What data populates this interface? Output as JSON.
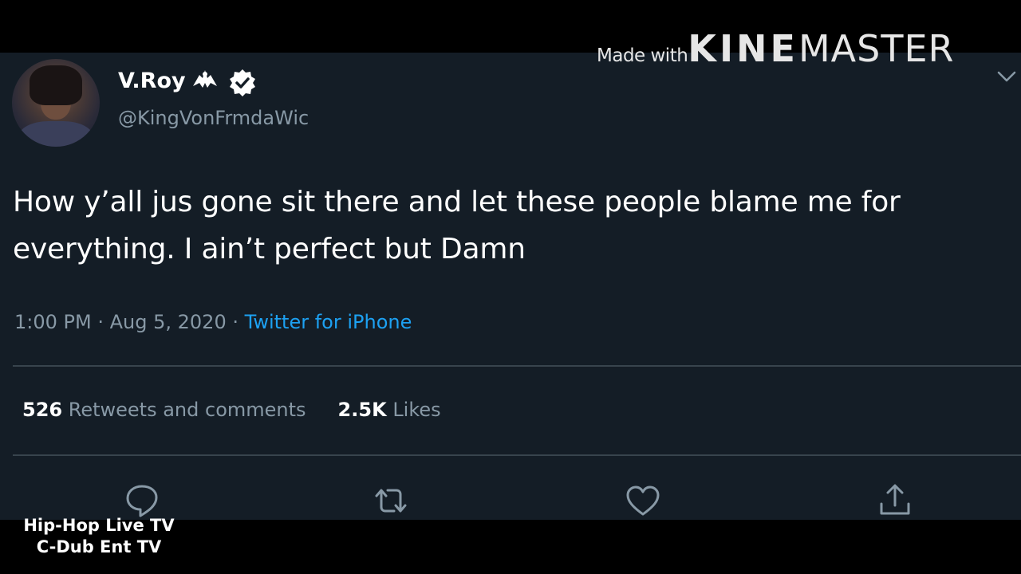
{
  "watermark": {
    "made_with": "Made with",
    "brand_bold": "KINE",
    "brand_light": "MASTER"
  },
  "tweet": {
    "display_name": "V.Roy",
    "handle": "@KingVonFrmdaWic",
    "badge_icons": [
      "eagle-icon",
      "verified-icon"
    ],
    "text": "How y’all jus gone sit there and let these people blame me for everything. I ain’t perfect but Damn",
    "time": "1:00 PM",
    "separator": "·",
    "date": "Aug 5, 2020",
    "source": "Twitter for iPhone",
    "stats": {
      "retweets_count": "526",
      "retweets_label": "Retweets and comments",
      "likes_count": "2.5K",
      "likes_label": "Likes"
    },
    "actions": [
      "reply-icon",
      "retweet-icon",
      "like-icon",
      "share-icon"
    ]
  },
  "credits": {
    "line1": "Hip-Hop Live TV",
    "line2": "C-Dub Ent TV"
  },
  "colors": {
    "background": "#141d26",
    "text_primary": "#ffffff",
    "text_secondary": "#8899a6",
    "link": "#1da1f2",
    "divider": "#38444d"
  }
}
